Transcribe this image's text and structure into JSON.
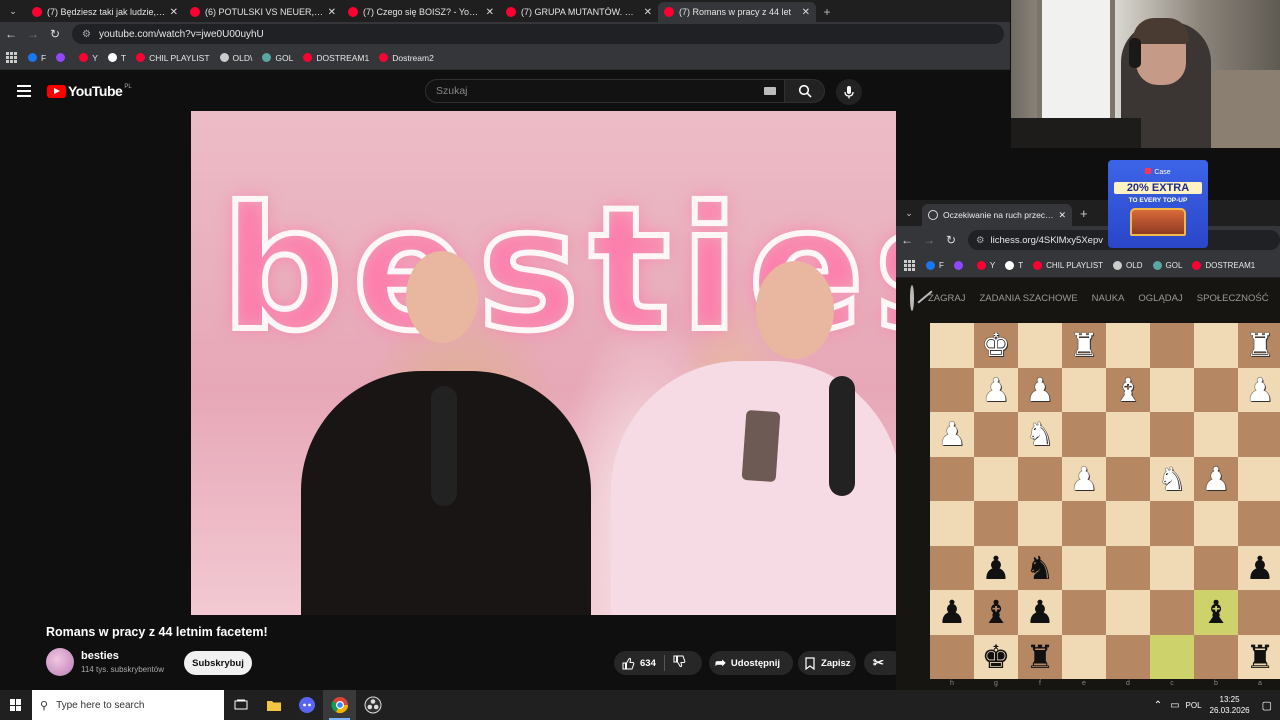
{
  "browser": {
    "tabs": [
      {
        "title": "(7) Będziesz taki jak ludzie, któr",
        "active": false
      },
      {
        "title": "(6) POTULSKI VS NEUER, MACI",
        "active": false
      },
      {
        "title": "(7) Czego się BOISZ? - YouTube",
        "active": false
      },
      {
        "title": "(7) GRUPA MUTANTÓW. WYRC",
        "active": false
      },
      {
        "title": "(7) Romans w pracy z 44 let",
        "active": true
      }
    ],
    "url": "youtube.com/watch?v=jwe0U00uyhU",
    "bookmarks": [
      {
        "label": "F",
        "color": "#1877f2"
      },
      {
        "label": "",
        "color": "#9146ff"
      },
      {
        "label": "Y",
        "color": "#ff0033"
      },
      {
        "label": "T",
        "color": "#ffffff"
      },
      {
        "label": "CHIL PLAYLIST",
        "color": "#ff0033"
      },
      {
        "label": "OLD\\",
        "color": "#cccccc"
      },
      {
        "label": "GOL",
        "color": "#5aa6a0"
      },
      {
        "label": "DOSTREAM1",
        "color": "#ff0033"
      },
      {
        "label": "Dostream2",
        "color": "#ff0033"
      }
    ]
  },
  "youtube": {
    "logo_text": "YouTube",
    "country_code": "PL",
    "search_placeholder": "Szukaj",
    "video_title": "Romans w pracy z 44 letnim facetem!",
    "channel_name": "besties",
    "subscriber_count": "114 tys. subskrybentów",
    "subscribe_label": "Subskrybuj",
    "like_count": "634",
    "share_label": "Udostępnij",
    "save_label": "Zapisz",
    "video_neon_text": "besties"
  },
  "ad": {
    "brand": "Case",
    "headline": "20% EXTRA",
    "subline": "TO EVERY TOP-UP"
  },
  "lichess": {
    "tab_title": "Oczekiwanie na ruch przeciwnik",
    "url": "lichess.org/4SKlMxy5Xepv",
    "bookmarks": [
      "F",
      "",
      "Y",
      "T",
      "CHIL PLAYLIST",
      "OLD",
      "GOL",
      "DOSTREAM1"
    ],
    "nav": [
      "ZAGRAJ",
      "ZADANIA SZACHOWE",
      "NAUKA",
      "OGLĄDAJ",
      "SPOŁECZNOŚĆ"
    ],
    "files": [
      "h",
      "g",
      "f",
      "e",
      "d",
      "c",
      "b",
      "a"
    ],
    "board": [
      [
        "",
        "K",
        "",
        "R",
        "",
        "",
        "",
        "R"
      ],
      [
        "",
        "P",
        "P",
        "",
        "B",
        "",
        "",
        "P"
      ],
      [
        "P",
        "",
        "N",
        "",
        "",
        "",
        "",
        ""
      ],
      [
        "",
        "",
        "",
        "P",
        "",
        "N",
        "P",
        ""
      ],
      [
        "",
        "",
        "",
        "",
        "",
        "",
        "",
        ""
      ],
      [
        "",
        "p",
        "n",
        "",
        "",
        "",
        "",
        "p"
      ],
      [
        "p",
        "b",
        "p",
        "",
        "",
        "",
        "b",
        ""
      ],
      [
        "",
        "k",
        "r",
        "",
        "",
        "",
        "",
        "r"
      ]
    ],
    "highlighted_squares": [
      "6-6",
      "7-5"
    ]
  },
  "taskbar": {
    "search_placeholder": "Type here to search",
    "language": "POL",
    "time": "13:25",
    "date": "26.03.2026"
  }
}
